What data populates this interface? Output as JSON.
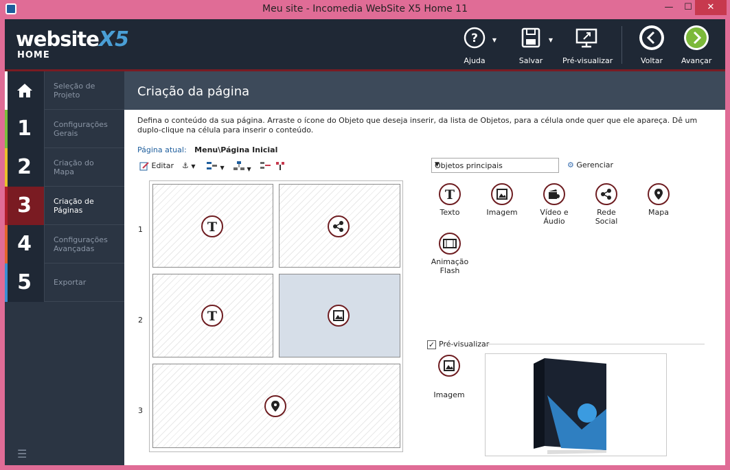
{
  "window": {
    "title": "Meu site - Incomedia WebSite X5 Home 11",
    "min": "—",
    "max": "☐",
    "close": "✕"
  },
  "logo": {
    "main": "website",
    "x5": "X5",
    "home": "HOME"
  },
  "toolbar": {
    "help": "Ajuda",
    "save": "Salvar",
    "preview": "Pré-visualizar",
    "back": "Voltar",
    "next": "Avançar"
  },
  "steps": [
    {
      "num": "",
      "label1": "Seleção de",
      "label2": "Projeto",
      "color": "#ffffff"
    },
    {
      "num": "1",
      "label1": "Configurações",
      "label2": "Gerais",
      "color": "#7bbf3d"
    },
    {
      "num": "2",
      "label1": "Criação do",
      "label2": "Mapa",
      "color": "#e8c12a"
    },
    {
      "num": "3",
      "label1": "Criação de",
      "label2": "Páginas",
      "color": "#b11e2b"
    },
    {
      "num": "4",
      "label1": "Configurações",
      "label2": "Avançadas",
      "color": "#e2642b"
    },
    {
      "num": "5",
      "label1": "Exportar",
      "label2": "",
      "color": "#3a8ed1"
    }
  ],
  "content": {
    "title": "Criação da página",
    "description": "Defina o conteúdo da sua página. Arraste o ícone do Objeto que deseja inserir, da lista de Objetos, para a célula onde quer que ele apareça. Dê um duplo-clique na célula para inserir o conteúdo.",
    "current_label": "Página atual:",
    "current_value": "Menu\\Página Inicial",
    "edit": "Editar",
    "rows": [
      "1",
      "2",
      "3"
    ]
  },
  "objects": {
    "category": "Objetos principais",
    "manage": "Gerenciar",
    "items": [
      {
        "l1": "Texto",
        "l2": ""
      },
      {
        "l1": "Imagem",
        "l2": ""
      },
      {
        "l1": "Vídeo e",
        "l2": "Áudio"
      },
      {
        "l1": "Rede",
        "l2": "Social"
      },
      {
        "l1": "Mapa",
        "l2": ""
      },
      {
        "l1": "Animação",
        "l2": "Flash"
      }
    ]
  },
  "preview": {
    "label": "Pré-visualizar",
    "checked": "✓",
    "object": "Imagem"
  }
}
